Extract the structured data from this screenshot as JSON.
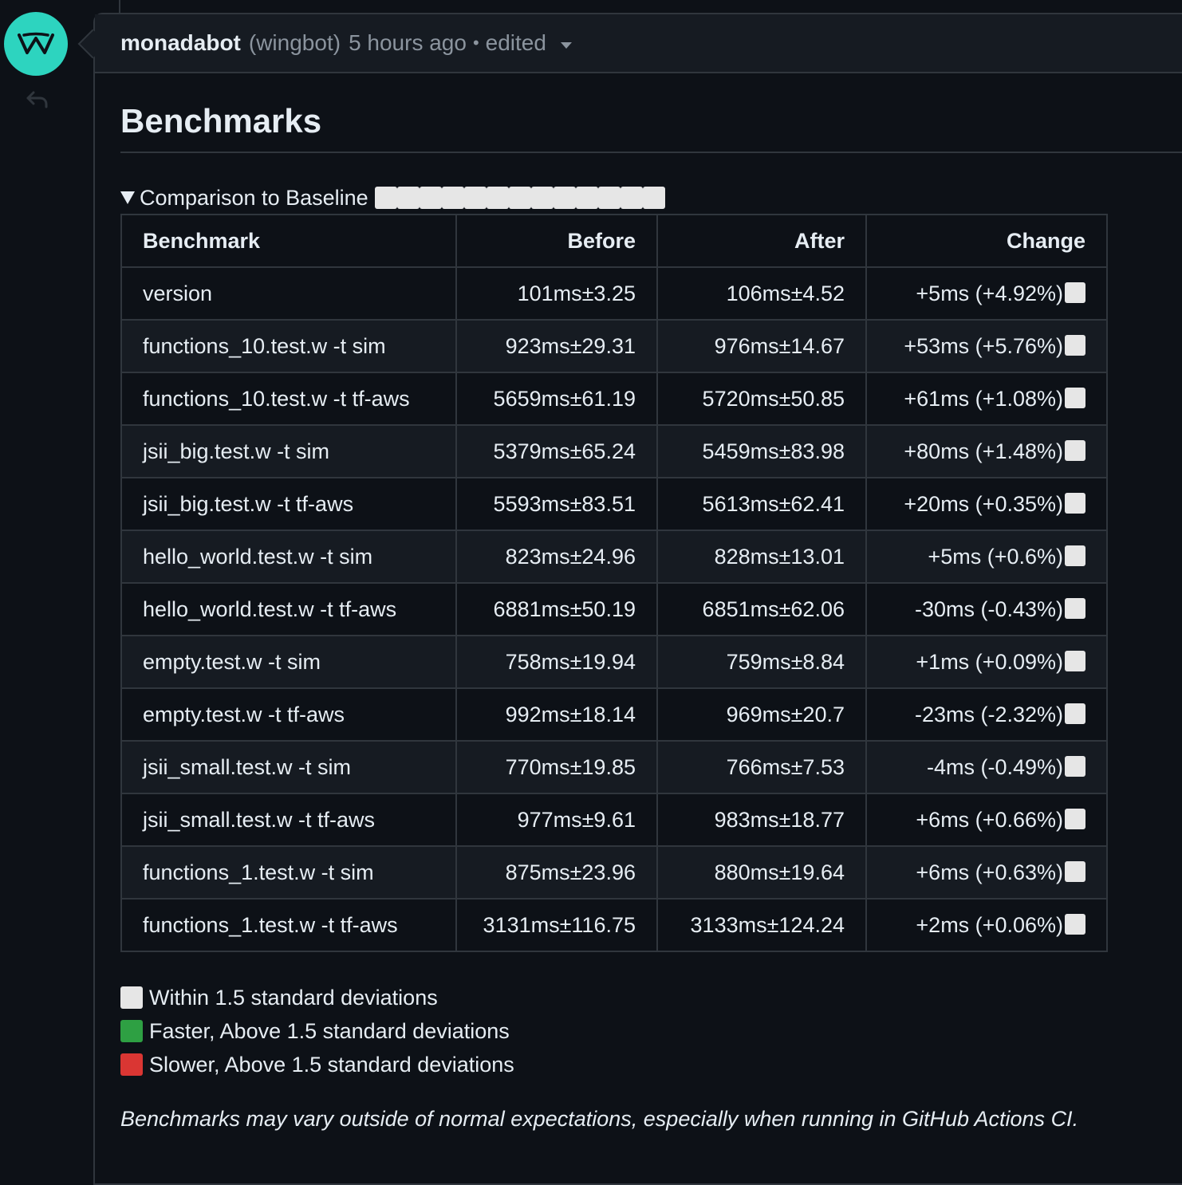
{
  "comment": {
    "author": "monadabot",
    "author_tag": "(wingbot)",
    "time": "5 hours ago",
    "separator": "•",
    "edited": "edited"
  },
  "content": {
    "heading": "Benchmarks",
    "details_summary": "Comparison to Baseline",
    "table": {
      "headers": [
        "Benchmark",
        "Before",
        "After",
        "Change"
      ],
      "rows": [
        [
          "version",
          "101ms±3.25",
          "106ms±4.52",
          "+5ms (+4.92%)"
        ],
        [
          "functions_10.test.w -t sim",
          "923ms±29.31",
          "976ms±14.67",
          "+53ms (+5.76%)"
        ],
        [
          "functions_10.test.w -t tf-aws",
          "5659ms±61.19",
          "5720ms±50.85",
          "+61ms (+1.08%)"
        ],
        [
          "jsii_big.test.w -t sim",
          "5379ms±65.24",
          "5459ms±83.98",
          "+80ms (+1.48%)"
        ],
        [
          "jsii_big.test.w -t tf-aws",
          "5593ms±83.51",
          "5613ms±62.41",
          "+20ms (+0.35%)"
        ],
        [
          "hello_world.test.w -t sim",
          "823ms±24.96",
          "828ms±13.01",
          "+5ms (+0.6%)"
        ],
        [
          "hello_world.test.w -t tf-aws",
          "6881ms±50.19",
          "6851ms±62.06",
          "-30ms (-0.43%)"
        ],
        [
          "empty.test.w -t sim",
          "758ms±19.94",
          "759ms±8.84",
          "+1ms (+0.09%)"
        ],
        [
          "empty.test.w -t tf-aws",
          "992ms±18.14",
          "969ms±20.7",
          "-23ms (-2.32%)"
        ],
        [
          "jsii_small.test.w -t sim",
          "770ms±19.85",
          "766ms±7.53",
          "-4ms (-0.49%)"
        ],
        [
          "jsii_small.test.w -t tf-aws",
          "977ms±9.61",
          "983ms±18.77",
          "+6ms (+0.66%)"
        ],
        [
          "functions_1.test.w -t sim",
          "875ms±23.96",
          "880ms±19.64",
          "+6ms (+0.63%)"
        ],
        [
          "functions_1.test.w -t tf-aws",
          "3131ms±116.75",
          "3133ms±124.24",
          "+2ms (+0.06%)"
        ]
      ]
    },
    "legend": [
      {
        "label": "Within 1.5 standard deviations",
        "color": "#e6e6e6"
      },
      {
        "label": "Faster, Above 1.5 standard deviations",
        "color": "#2ea043"
      },
      {
        "label": "Slower, Above 1.5 standard deviations",
        "color": "#da3633"
      }
    ],
    "note": "Benchmarks may vary outside of normal expectations, especially when running in GitHub Actions CI."
  },
  "icons": {
    "avatar": "wing-logo-icon",
    "reply": "reply-arrow-icon",
    "dropdown": "chevron-down-icon",
    "details": "triangle-down-icon"
  }
}
